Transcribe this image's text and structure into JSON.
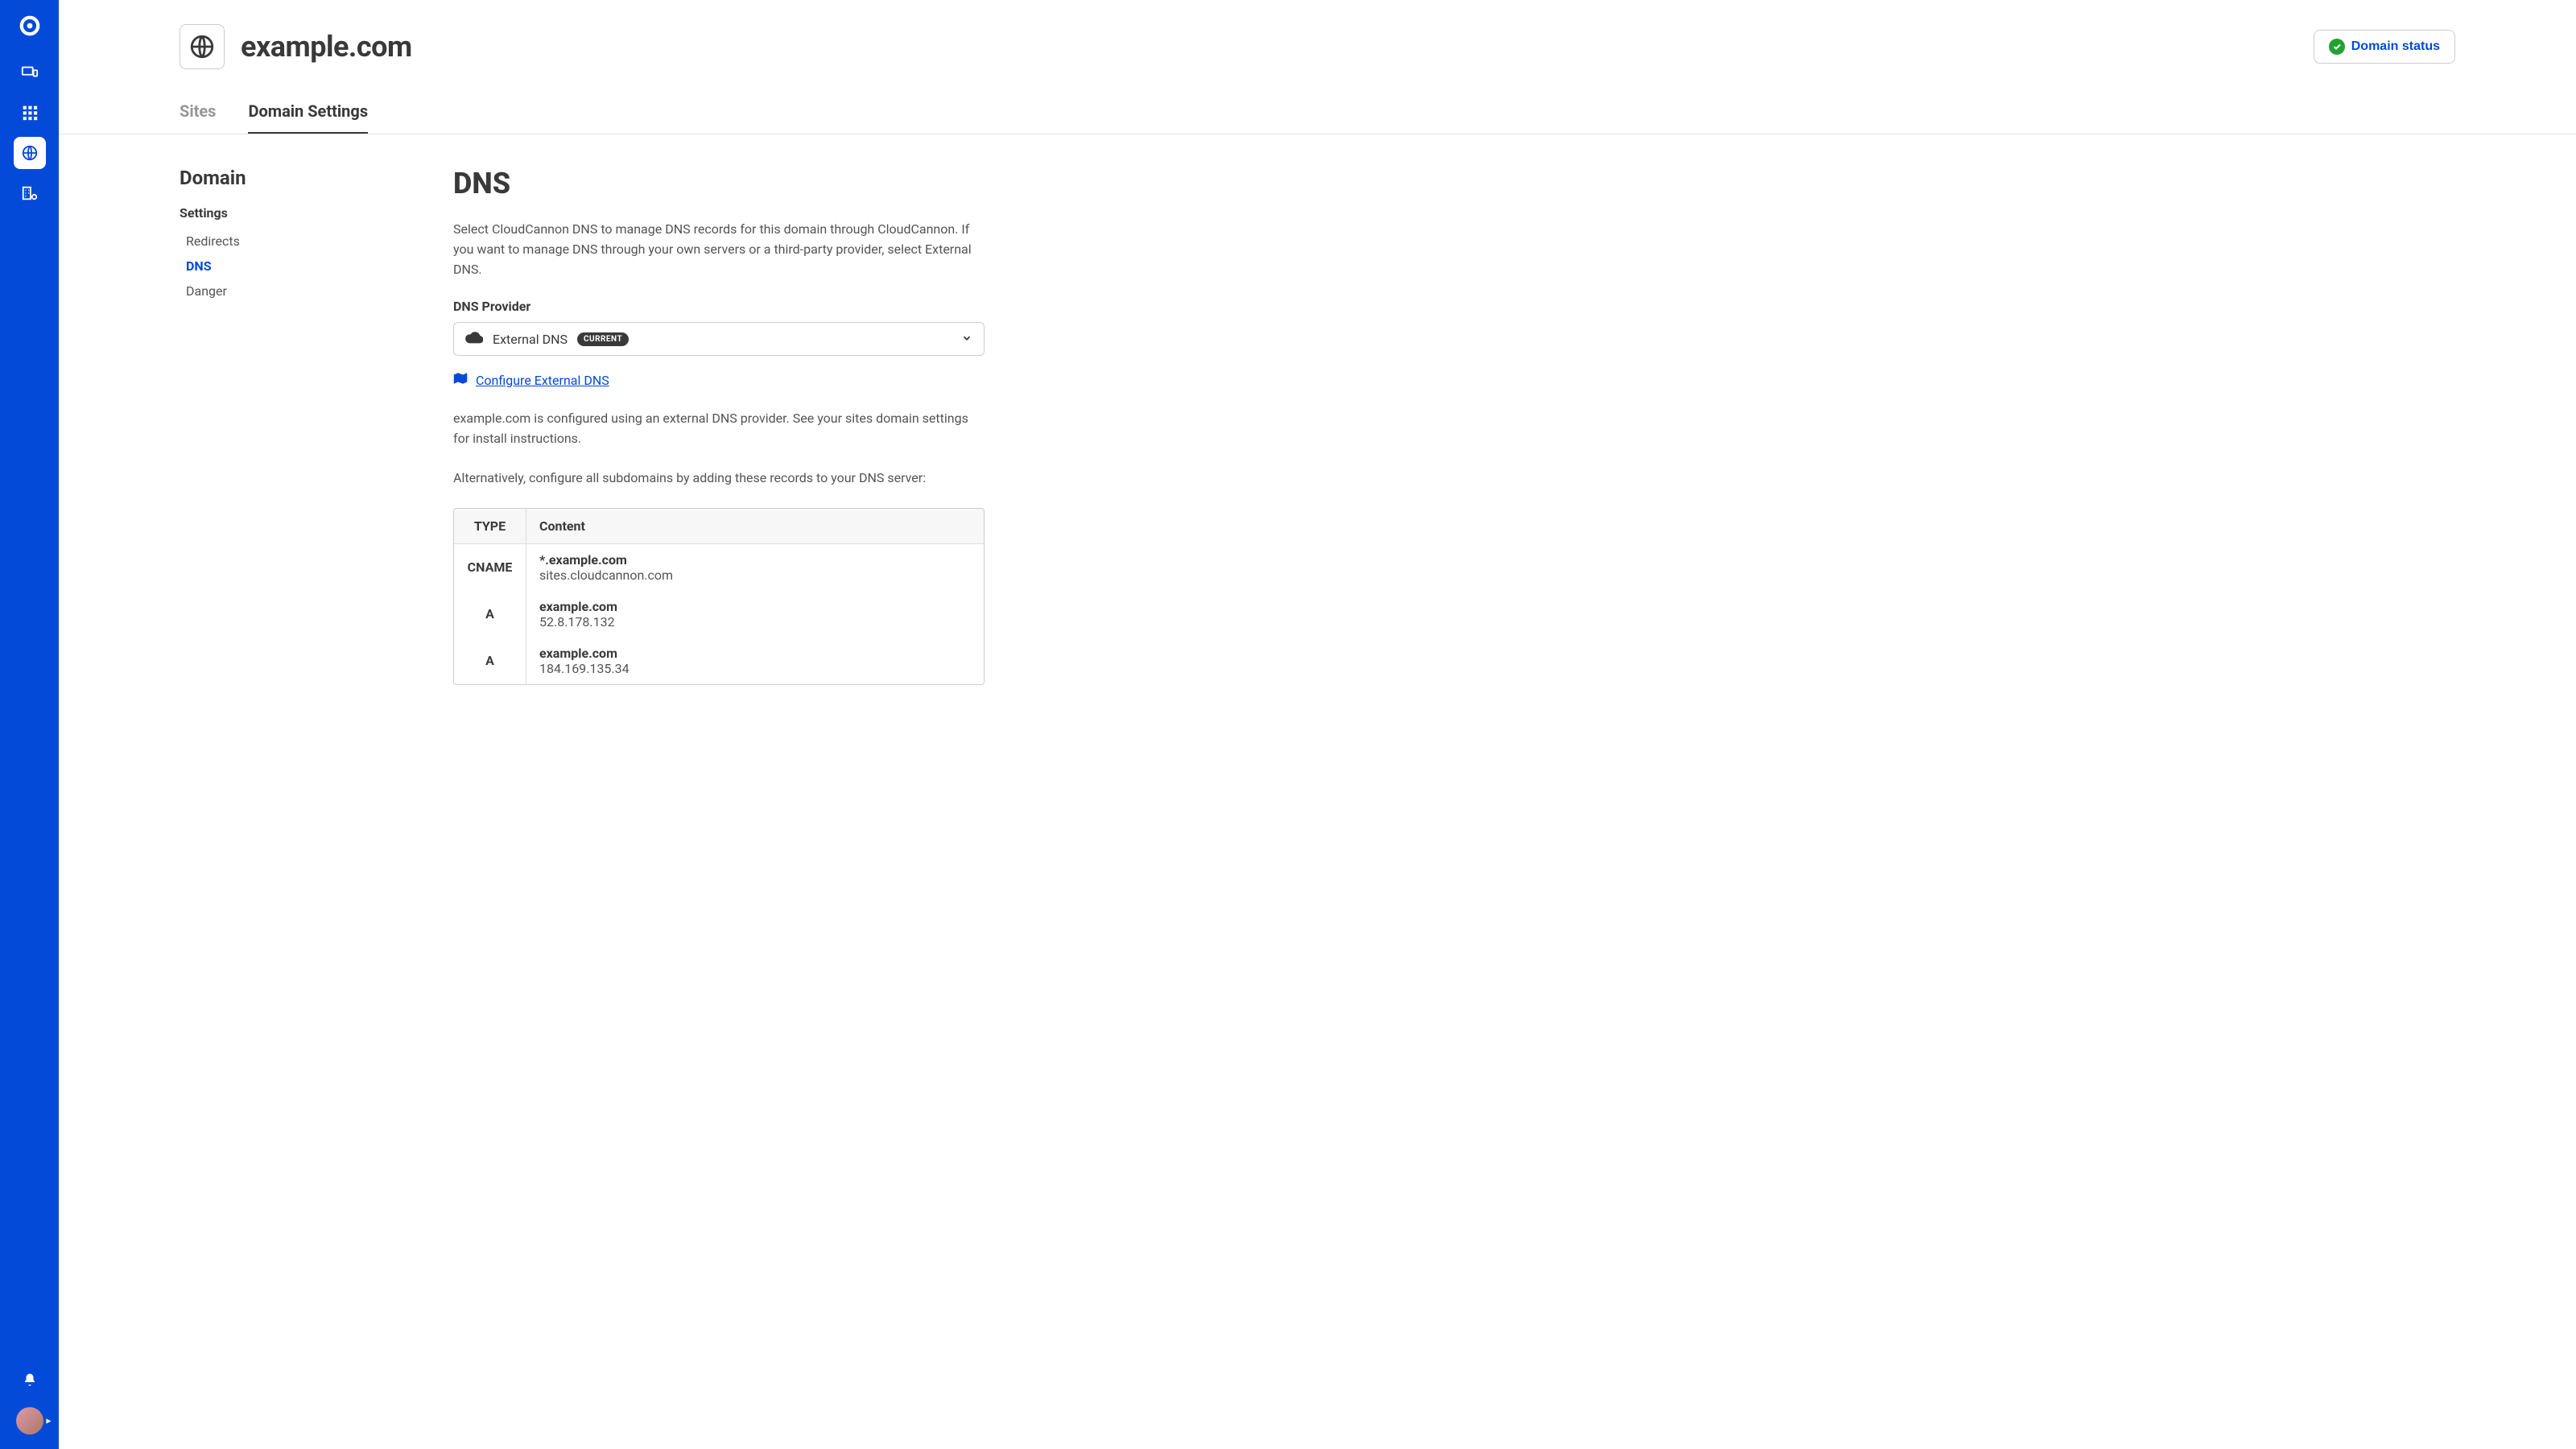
{
  "header": {
    "domain_title": "example.com",
    "status_button": "Domain status",
    "tabs": {
      "sites": "Sites",
      "settings": "Domain Settings"
    }
  },
  "sidebar": {
    "icons": [
      "logo",
      "devices",
      "grid",
      "globe",
      "gear-building"
    ]
  },
  "leftnav": {
    "heading": "Domain",
    "section_label": "Settings",
    "items": [
      {
        "label": "Redirects"
      },
      {
        "label": "DNS",
        "selected": true
      },
      {
        "label": "Danger"
      }
    ]
  },
  "content": {
    "title": "DNS",
    "description": "Select CloudCannon DNS to manage DNS records for this domain through CloudCannon. If you want to manage DNS through your own servers or a third-party provider, select External DNS.",
    "provider_label": "DNS Provider",
    "provider_value": "External DNS",
    "provider_badge": "CURRENT",
    "configure_link": "Configure External DNS",
    "info1": "example.com is configured using an external DNS provider. See your sites domain settings for install instructions.",
    "info2": "Alternatively, configure all subdomains by adding these records to your DNS server:",
    "table": {
      "headers": {
        "type": "TYPE",
        "content": "Content"
      },
      "rows": [
        {
          "type": "CNAME",
          "name": "*.example.com",
          "value": "sites.cloudcannon.com"
        },
        {
          "type": "A",
          "name": "example.com",
          "value": "52.8.178.132"
        },
        {
          "type": "A",
          "name": "example.com",
          "value": "184.169.135.34"
        }
      ]
    }
  }
}
